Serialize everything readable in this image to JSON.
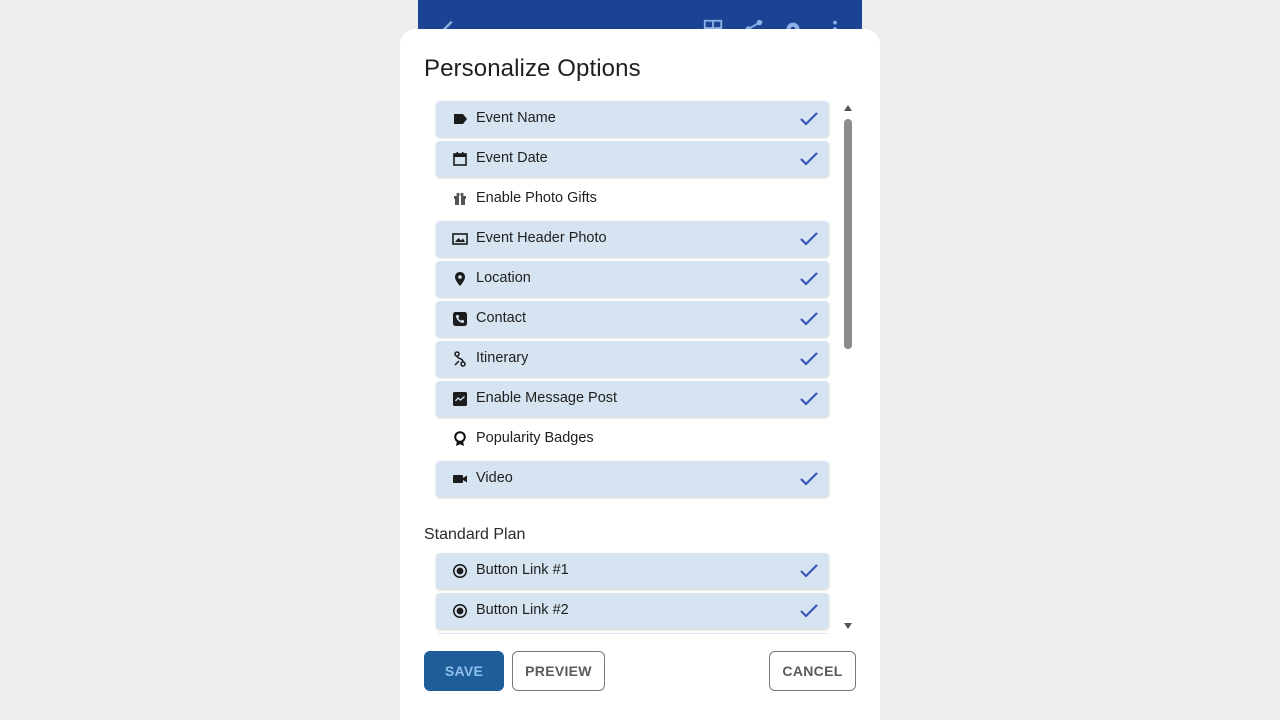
{
  "app_bar": {
    "icons": [
      "back-icon",
      "layout-icon",
      "share-icon",
      "settings-icon",
      "more-icon"
    ]
  },
  "dialog": {
    "title": "Personalize Options",
    "options": [
      {
        "label": "Event Name",
        "icon": "label-icon",
        "selected": true
      },
      {
        "label": "Event Date",
        "icon": "calendar-icon",
        "selected": true
      },
      {
        "label": "Enable Photo Gifts",
        "icon": "gift-icon",
        "selected": false
      },
      {
        "label": "Event Header Photo",
        "icon": "photo-icon",
        "selected": true
      },
      {
        "label": "Location",
        "icon": "location-pin-icon",
        "selected": true
      },
      {
        "label": "Contact",
        "icon": "phone-icon",
        "selected": true
      },
      {
        "label": "Itinerary",
        "icon": "route-icon",
        "selected": true
      },
      {
        "label": "Enable Message Post",
        "icon": "message-icon",
        "selected": true
      },
      {
        "label": "Popularity Badges",
        "icon": "badge-icon",
        "selected": false
      },
      {
        "label": "Video",
        "icon": "video-camera-icon",
        "selected": true
      }
    ],
    "section_title": "Standard Plan",
    "plan_options": [
      {
        "label": "Button Link #1",
        "icon": "radio-button-icon",
        "selected": true
      },
      {
        "label": "Button Link #2",
        "icon": "radio-button-icon",
        "selected": true
      }
    ],
    "buttons": {
      "save": "SAVE",
      "preview": "PREVIEW",
      "cancel": "CANCEL"
    }
  },
  "colors": {
    "app_bar": "#1a4493",
    "selected_row": "#d6e3f0",
    "check": "#3d54b8",
    "save_button": "#1f5d99"
  }
}
